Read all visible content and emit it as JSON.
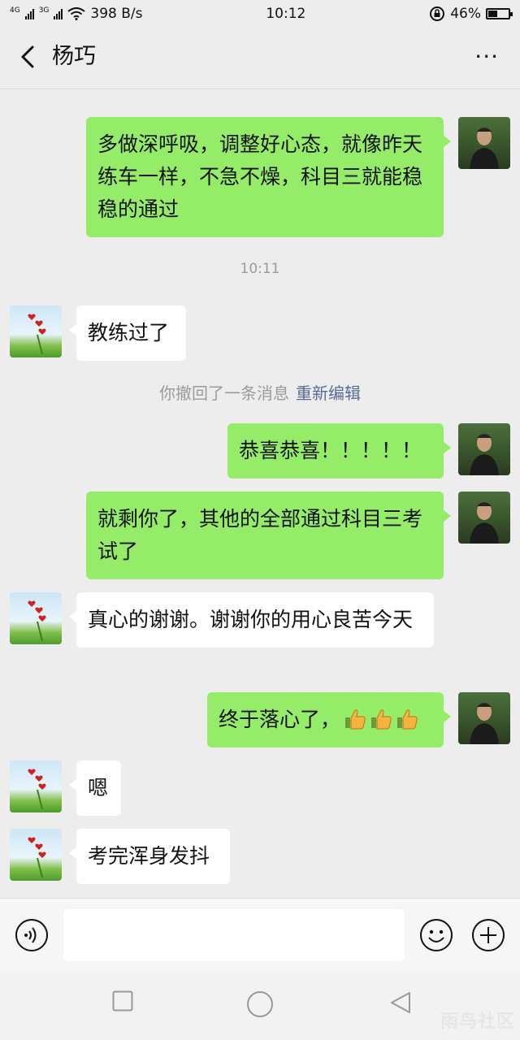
{
  "status_bar": {
    "network_1": "4G",
    "network_2": "3G",
    "speed": "398 B/s",
    "time": "10:12",
    "battery": "46%",
    "battery_level": 0.46
  },
  "header": {
    "title": "杨巧",
    "more_label": "···"
  },
  "messages": {
    "m1": "多做深呼吸，调整好心态，就像昨天练车一样，不急不燥，科目三就能稳稳的通过",
    "timestamp": "10:11",
    "m2": "教练过了",
    "recall_text": "你撤回了一条消息",
    "recall_action": "重新编辑",
    "m3": "恭喜恭喜！！！！！",
    "m4": "就剩你了，其他的全部通过科目三考试了",
    "m5": "真心的谢谢。谢谢你的用心良苦今天",
    "m6": "终于落心了，",
    "m7": "嗯",
    "m8": "考完浑身发抖"
  },
  "input": {
    "placeholder": ""
  },
  "watermark": "雨鸟社区"
}
